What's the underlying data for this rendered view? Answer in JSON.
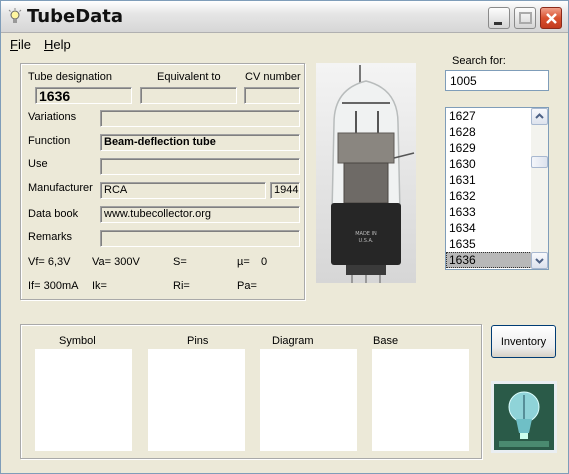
{
  "window": {
    "title": "TubeData"
  },
  "menu": {
    "file": "File",
    "help": "Help"
  },
  "header_labels": {
    "designation": "Tube designation",
    "equivalent": "Equivalent to",
    "cv": "CV number"
  },
  "tube": {
    "designation": "1636",
    "equivalent": "",
    "cv_number": "",
    "variations": "",
    "function": "Beam-deflection tube",
    "use": "",
    "manufacturer": "RCA",
    "year": "1944",
    "data_book": "www.tubecollector.org",
    "remarks": ""
  },
  "field_labels": {
    "variations": "Variations",
    "function": "Function",
    "use": "Use",
    "manufacturer": "Manufacturer",
    "data_book": "Data book",
    "remarks": "Remarks"
  },
  "params": {
    "vf": "Vf= 6,3V",
    "va": "Va= 300V",
    "s": "S=",
    "mu": "µ=",
    "mu_value": "0",
    "if": "If= 300mA",
    "ik": "Ik=",
    "ri": "Ri=",
    "pa": "Pa="
  },
  "search": {
    "label": "Search for:",
    "value": "1005"
  },
  "tube_list": {
    "items": [
      "1627",
      "1628",
      "1629",
      "1630",
      "1631",
      "1632",
      "1633",
      "1634",
      "1635",
      "1636"
    ],
    "selected": "1636"
  },
  "images": {
    "symbol": "Symbol",
    "pins": "Pins",
    "diagram": "Diagram",
    "base": "Base"
  },
  "buttons": {
    "inventory": "Inventory"
  },
  "icons": {
    "app": "lightbulb-icon",
    "minimize": "minimize-icon",
    "maximize": "maximize-icon",
    "close": "close-icon",
    "scroll_up": "arrow-up-icon",
    "scroll_down": "arrow-down-icon"
  },
  "colors": {
    "close_button": "#d9512f",
    "list_selection": "#b8b8b8",
    "logo_background": "#2a5a48"
  }
}
